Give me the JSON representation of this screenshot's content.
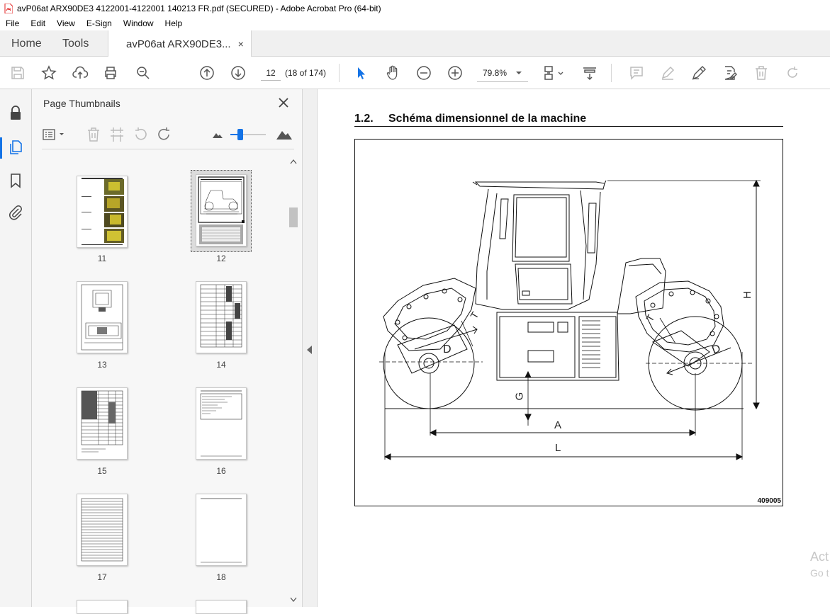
{
  "window": {
    "title": "avP06at ARX90DE3 4122001-4122001 140213 FR.pdf (SECURED) - Adobe Acrobat Pro (64-bit)"
  },
  "menu": [
    "File",
    "Edit",
    "View",
    "E-Sign",
    "Window",
    "Help"
  ],
  "tabs": {
    "home": "Home",
    "tools": "Tools",
    "document": "avP06at ARX90DE3...",
    "close": "×"
  },
  "toolbar": {
    "page_number": "12",
    "page_count": "(18 of 174)",
    "zoom": "79.8%"
  },
  "thumbnails_panel": {
    "title": "Page Thumbnails",
    "pages": [
      "11",
      "12",
      "13",
      "14",
      "15",
      "16",
      "17",
      "18"
    ],
    "selected_page": "12"
  },
  "document": {
    "section_number": "1.2.",
    "section_title": "Schéma dimensionnel de la machine",
    "dimension_labels": {
      "A": "A",
      "L": "L",
      "H": "H",
      "G": "G",
      "D_front": "D",
      "D_rear": "D",
      "T_front": "T",
      "T_rear": "T"
    },
    "figure_code": "409005"
  },
  "watermark": {
    "line1": "Act",
    "line2": "Go t"
  },
  "colors": {
    "accent": "#1473e6",
    "pdf_red": "#e02020"
  }
}
